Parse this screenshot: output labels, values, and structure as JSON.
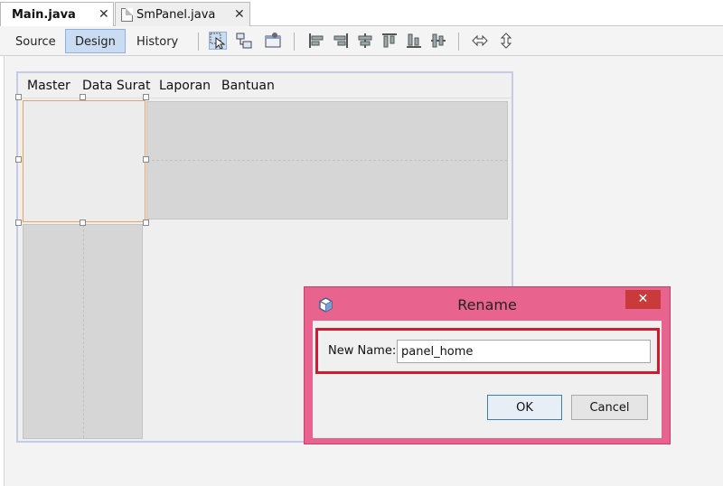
{
  "tabs": [
    {
      "label": "Main.java",
      "active": true,
      "close": "✕"
    },
    {
      "label": "SmPanel.java",
      "active": false,
      "close": "✕",
      "icon": "file-icon"
    }
  ],
  "toolbar": {
    "modes": [
      "Source",
      "Design",
      "History"
    ],
    "active_mode": "Design",
    "icons": [
      "selection-mode-icon",
      "connection-mode-icon",
      "preview-design-icon",
      "align-left-icon",
      "align-right-icon",
      "center-horizontally-icon",
      "align-top-icon",
      "align-bottom-icon",
      "center-vertically-icon",
      "change-horizontal-resizability-icon",
      "change-vertical-resizability-icon"
    ]
  },
  "form": {
    "menu": [
      "Master",
      "Data Surat",
      "Laporan",
      "Bantuan"
    ]
  },
  "dialog": {
    "title": "Rename",
    "close": "✕",
    "label": "New Name:",
    "value": "panel_home",
    "ok": "OK",
    "cancel": "Cancel",
    "icon": "java-app-icon"
  },
  "colors": {
    "dialog_frame": "#e8648e",
    "highlight_box": "#d9162f",
    "selection_border": "#f0a060",
    "active_mode_bg": "#c9dcf2"
  }
}
